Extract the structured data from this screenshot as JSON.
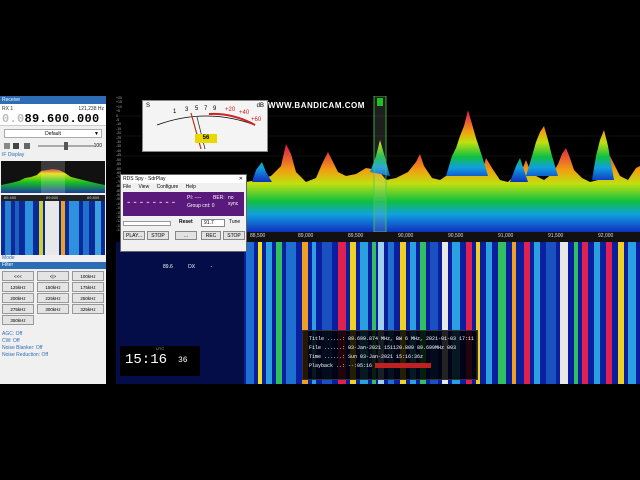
{
  "side": {
    "header": "Receive",
    "rx_label": "RX 1",
    "rx_hz": "121,238 Hz",
    "freq_dim": "0.0",
    "freq_main": "89.600.000",
    "profile": "Default",
    "volume_value": "100",
    "display_section": "IF Display",
    "ticks": [
      "89.400",
      "89.600",
      "89.800"
    ],
    "mode_section": "Mode",
    "filter_section": "Filter",
    "filter_buttons": [
      "<<<",
      "<|>",
      "100kHz",
      "125kHz",
      "150kHz",
      "175kHz",
      "200kHz",
      "225kHz",
      "250kHz",
      "275kHz",
      "300kHz",
      "325kHz",
      "350kHz"
    ],
    "options": [
      "AGC: Off",
      "CW: Off",
      "Noise Blanker: Off",
      "Noise Reduction: Off"
    ]
  },
  "smeter": {
    "s_label": "S",
    "db_label": "dB",
    "signal_value": "56",
    "scale": [
      "1",
      "3",
      "5",
      "7",
      "9",
      "+20",
      "+40",
      "+60"
    ]
  },
  "watermark": "WWW.BANDICAM.COM",
  "freq_axis": [
    "88,500",
    "89,000",
    "89,500",
    "90,000",
    "90,500",
    "91,000",
    "91,500",
    "92,000"
  ],
  "spectrum_scale": [
    "+20",
    "+15",
    "+10",
    "+5",
    "0",
    "-5",
    "-10",
    "-15",
    "-20",
    "-25",
    "-30",
    "-35",
    "-40",
    "-45",
    "-50",
    "-55",
    "-60",
    "-65",
    "-70",
    "-75",
    "-80",
    "-85",
    "-90",
    "-95",
    "-100",
    "-105",
    "-110",
    "-115",
    "-120",
    "-125",
    "-130"
  ],
  "rds": {
    "title": "RDS Spy - SdrPlay",
    "menu": [
      "File",
      "View",
      "Configure",
      "Help"
    ],
    "ps": "--------",
    "pi": "PI: ----",
    "ber": "BER:",
    "sync": "no sync",
    "group": "Group cnt: 0",
    "reset": "Reset",
    "select": "91.7",
    "tune": "Tune",
    "buttons": [
      "PLAY...",
      "STOP",
      "...",
      "REC",
      "STOP"
    ]
  },
  "clock": {
    "time": "15:16",
    "seconds": "36",
    "label": "UTC"
  },
  "dx": {
    "freq": "89.6",
    "mode": "DX",
    "sep": "-"
  },
  "playback": {
    "title": "Title .....: 89.699.874 MHz, BW 6 MHz, 2021-01-03 17:11",
    "file": "File ......: 03-Jan-2021 151120.809 89.699MHz 003",
    "time": "Time ......: Sun 03-Jan-2021 15:16:36z",
    "playback": "Playback ..: --:05:16"
  },
  "colors": {
    "accent": "#2c6db5",
    "meter": "#e8d800",
    "rds_panel": "#5a1a7c"
  }
}
